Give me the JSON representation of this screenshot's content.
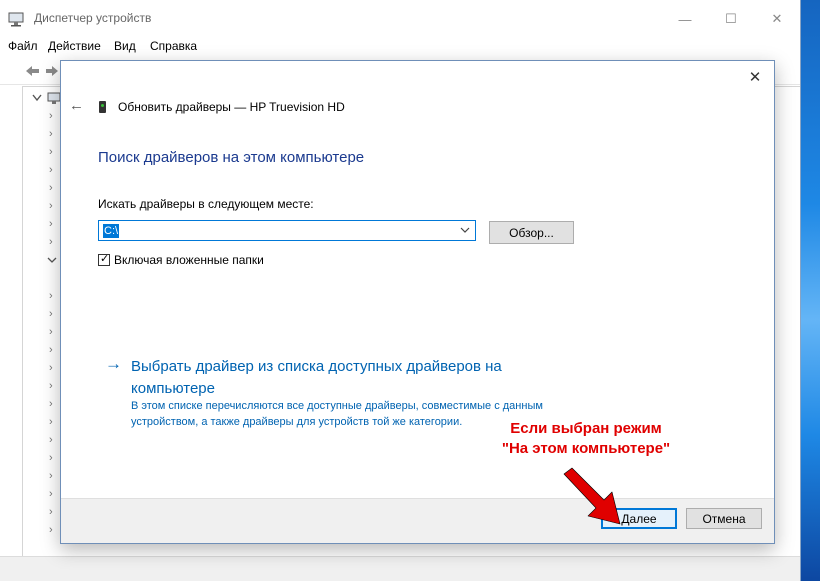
{
  "window": {
    "title": "Диспетчер устройств",
    "controls": {
      "minimize": "—",
      "maximize": "☐",
      "close": "✕"
    }
  },
  "menu": [
    "Файл",
    "Действие",
    "Вид",
    "Справка"
  ],
  "dialog": {
    "title": "Обновить драйверы — HP Truevision HD",
    "heading": "Поиск драйверов на этом компьютере",
    "search_label": "Искать драйверы в следующем месте:",
    "path_value": "C:\\",
    "browse_label": "Обзор...",
    "include_subfolders_label": "Включая вложенные папки",
    "include_subfolders_checked": true,
    "pick_link_title": "Выбрать драйвер из списка доступных драйверов на компьютере",
    "pick_link_desc": "В этом списке перечисляются все доступные драйверы, совместимые с данным устройством, а также драйверы для устройств той же категории.",
    "next_label": "Далее",
    "cancel_label": "Отмена",
    "close_glyph": "✕",
    "back_glyph": "←"
  },
  "annotation": {
    "line1": "Если выбран режим",
    "line2": "\"На этом компьютере\""
  },
  "colors": {
    "accent": "#0078d7",
    "heading": "#1b3a8f",
    "link": "#0063b1",
    "annotation": "#e00000"
  },
  "icons": [
    "device-manager-icon",
    "back-arrow-icon",
    "webcam-icon",
    "close-icon",
    "chevron-down-icon",
    "checkbox-check-icon",
    "right-arrow-icon",
    "red-pointer-arrow"
  ]
}
